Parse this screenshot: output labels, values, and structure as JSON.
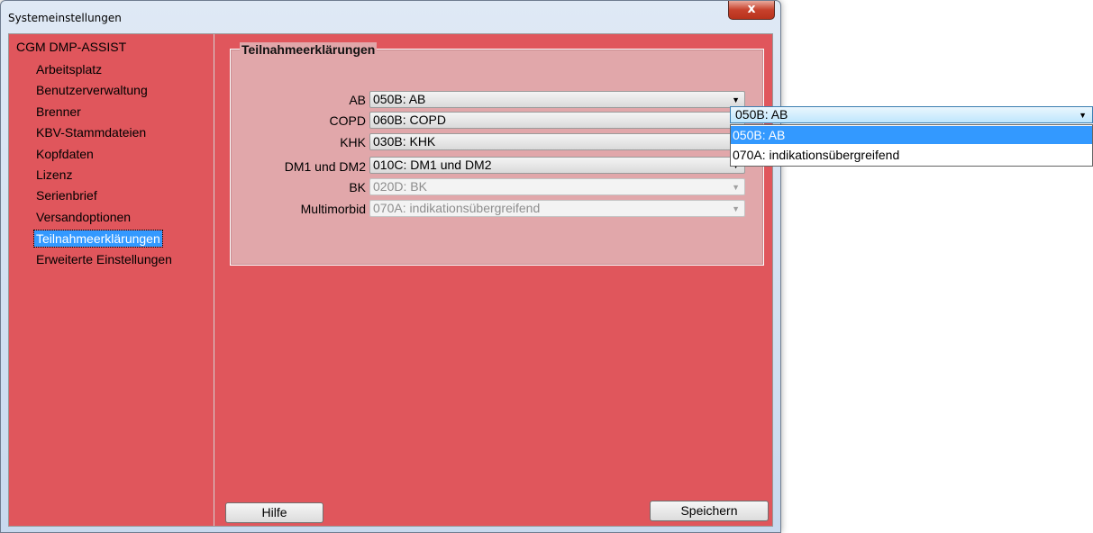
{
  "window": {
    "title": "Systemeinstellungen",
    "close_label": "x"
  },
  "tree": {
    "root": "CGM DMP-ASSIST",
    "items": [
      {
        "label": "Arbeitsplatz"
      },
      {
        "label": "Benutzerverwaltung"
      },
      {
        "label": "Brenner"
      },
      {
        "label": "KBV-Stammdateien"
      },
      {
        "label": "Kopfdaten"
      },
      {
        "label": "Lizenz"
      },
      {
        "label": "Serienbrief"
      },
      {
        "label": "Versandoptionen"
      },
      {
        "label": "Teilnahmeerklärungen",
        "selected": true
      },
      {
        "label": "Erweiterte Einstellungen"
      }
    ]
  },
  "group": {
    "title": "Teilnahmeerklärungen",
    "fields": [
      {
        "label": "AB",
        "value": "050B: AB",
        "enabled": true
      },
      {
        "label": "COPD",
        "value": "060B: COPD",
        "enabled": true
      },
      {
        "label": "KHK",
        "value": "030B: KHK",
        "enabled": true
      },
      {
        "label": "DM1 und DM2",
        "value": "010C: DM1 und DM2",
        "enabled": true
      },
      {
        "label": "BK",
        "value": "020D: BK",
        "enabled": false
      },
      {
        "label": "Multimorbid",
        "value": "070A: indikationsübergreifend",
        "enabled": false
      }
    ]
  },
  "buttons": {
    "help": "Hilfe",
    "save": "Speichern"
  },
  "dropdown": {
    "current": "050B: AB",
    "options": [
      "050B: AB",
      "070A: indikationsübergreifend"
    ],
    "selected_index": 0
  },
  "colors": {
    "panel": "#e0565c",
    "group": "#e1a7aa",
    "selection": "#3399ff"
  }
}
